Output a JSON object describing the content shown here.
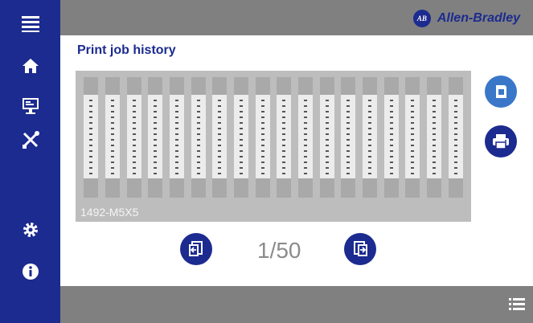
{
  "brand": {
    "logo_text": "AB",
    "name": "Allen-Bradley",
    "accent_color": "#1c2b8f"
  },
  "sidebar": {
    "items": [
      {
        "icon": "menu-icon"
      },
      {
        "icon": "home-icon"
      },
      {
        "icon": "monitor-icon"
      },
      {
        "icon": "tools-icon"
      },
      {
        "icon": "settings-icon"
      },
      {
        "icon": "info-icon"
      }
    ]
  },
  "page": {
    "title": "Print job history"
  },
  "preview": {
    "label": "1492-M5X5",
    "terminal_count": 18
  },
  "actions": [
    {
      "icon": "cartridge-icon"
    },
    {
      "icon": "print-icon"
    }
  ],
  "pager": {
    "text": "1/50",
    "prev_icon": "previous-page-icon",
    "next_icon": "next-page-icon"
  },
  "bottombar": {
    "icon": "list-icon"
  }
}
